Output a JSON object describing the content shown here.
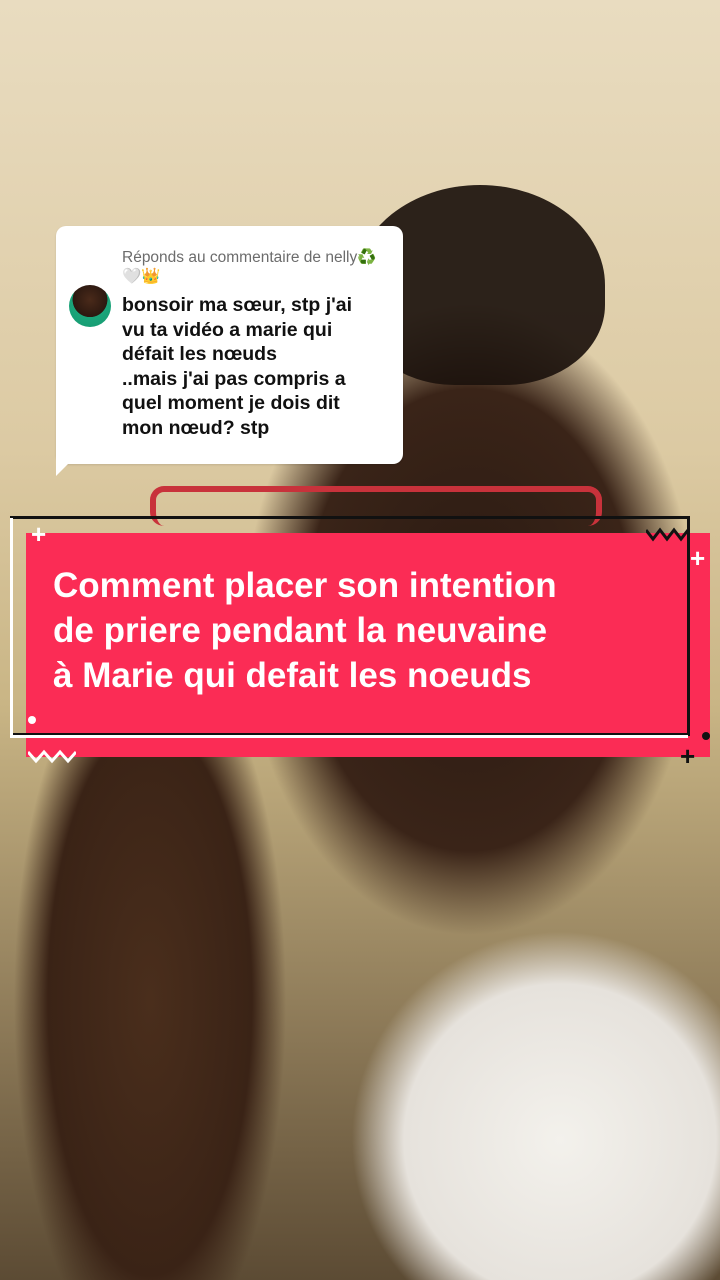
{
  "reply": {
    "header": "Réponds au commentaire de nelly♻️🤍👑",
    "lines": [
      "bonsoir ma sœur, stp j'ai",
      "vu ta vidéo a marie qui",
      "défait les nœuds",
      "..mais j'ai pas compris a",
      "quel moment je dois dit",
      "mon nœud? stp"
    ]
  },
  "title": {
    "lines": [
      "Comment placer son intention",
      "de priere pendant la neuvaine",
      "à Marie qui defait les noeuds"
    ]
  },
  "colors": {
    "banner": "#fb2c55",
    "bubble": "#ffffff",
    "accent_dark": "#111111"
  },
  "icons": [
    "avatar",
    "plus-icon",
    "zigzag-icon",
    "dot-icon"
  ]
}
